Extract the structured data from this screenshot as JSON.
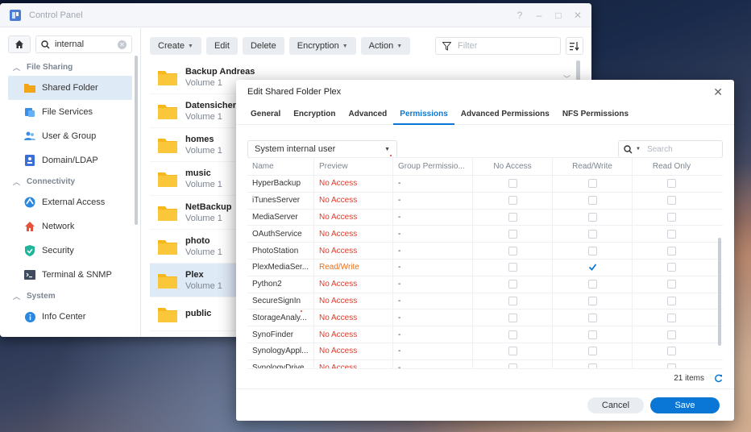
{
  "window": {
    "title": "Control Panel",
    "controls": {
      "help": "?",
      "minimize": "–",
      "maximize": "□",
      "close": "✕"
    }
  },
  "sidebar": {
    "search_value": "internal",
    "sections": [
      {
        "label": "File Sharing",
        "items": [
          {
            "label": "Shared Folder",
            "icon": "shared-folder-icon",
            "active": true
          },
          {
            "label": "File Services",
            "icon": "file-services-icon"
          },
          {
            "label": "User & Group",
            "icon": "user-group-icon"
          },
          {
            "label": "Domain/LDAP",
            "icon": "domain-ldap-icon"
          }
        ]
      },
      {
        "label": "Connectivity",
        "items": [
          {
            "label": "External Access",
            "icon": "external-access-icon"
          },
          {
            "label": "Network",
            "icon": "network-icon"
          },
          {
            "label": "Security",
            "icon": "security-icon"
          },
          {
            "label": "Terminal & SNMP",
            "icon": "terminal-icon"
          }
        ]
      },
      {
        "label": "System",
        "items": [
          {
            "label": "Info Center",
            "icon": "info-center-icon"
          }
        ]
      }
    ]
  },
  "toolbar": {
    "create": "Create",
    "edit": "Edit",
    "delete": "Delete",
    "encryption": "Encryption",
    "action": "Action",
    "filter_placeholder": "Filter"
  },
  "folders": [
    {
      "name": "Backup Andreas",
      "volume": "Volume 1"
    },
    {
      "name": "Datensicherung",
      "volume": "Volume 1"
    },
    {
      "name": "homes",
      "volume": "Volume 1"
    },
    {
      "name": "music",
      "volume": "Volume 1"
    },
    {
      "name": "NetBackup",
      "volume": "Volume 1"
    },
    {
      "name": "photo",
      "volume": "Volume 1"
    },
    {
      "name": "Plex",
      "volume": "Volume 1",
      "active": true
    },
    {
      "name": "public",
      "volume": ""
    }
  ],
  "dialog": {
    "title": "Edit Shared Folder Plex",
    "tabs": [
      "General",
      "Encryption",
      "Advanced",
      "Permissions",
      "Advanced Permissions",
      "NFS Permissions"
    ],
    "active_tab": "Permissions",
    "user_type": "System internal user",
    "search_placeholder": "Search",
    "columns": [
      "Name",
      "Preview",
      "Group Permissio...",
      "No Access",
      "Read/Write",
      "Read Only"
    ],
    "rows": [
      {
        "name": "HyperBackup",
        "preview": "No Access",
        "group": "-",
        "rw": false
      },
      {
        "name": "iTunesServer",
        "preview": "No Access",
        "group": "-",
        "rw": false
      },
      {
        "name": "MediaServer",
        "preview": "No Access",
        "group": "-",
        "rw": false
      },
      {
        "name": "OAuthService",
        "preview": "No Access",
        "group": "-",
        "rw": false
      },
      {
        "name": "PhotoStation",
        "preview": "No Access",
        "group": "-",
        "rw": false
      },
      {
        "name": "PlexMediaSer...",
        "preview": "Read/Write",
        "group": "-",
        "rw": true
      },
      {
        "name": "Python2",
        "preview": "No Access",
        "group": "-",
        "rw": false
      },
      {
        "name": "SecureSignIn",
        "preview": "No Access",
        "group": "-",
        "rw": false
      },
      {
        "name": "StorageAnaly...",
        "preview": "No Access",
        "group": "-",
        "rw": false
      },
      {
        "name": "SynoFinder",
        "preview": "No Access",
        "group": "-",
        "rw": false
      },
      {
        "name": "SynologyAppl...",
        "preview": "No Access",
        "group": "-",
        "rw": false
      },
      {
        "name": "SynologyDrive",
        "preview": "No Access",
        "group": "-",
        "rw": false
      }
    ],
    "item_count": "21 items",
    "cancel": "Cancel",
    "save": "Save"
  },
  "colors": {
    "accent": "#0a77d6",
    "no_access": "#e13a2b",
    "read_write": "#e86f1a",
    "folder": "#f6b81c"
  }
}
